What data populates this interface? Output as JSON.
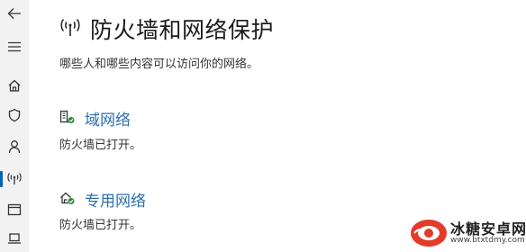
{
  "page": {
    "title": "防火墙和网络保护",
    "subtitle": "哪些人和哪些内容可以访问你的网络。",
    "header_icon": "wireless-antenna-icon"
  },
  "sidebar": {
    "items": [
      {
        "name": "back",
        "icon": "back-arrow-icon"
      },
      {
        "name": "menu",
        "icon": "hamburger-icon"
      },
      {
        "name": "home",
        "icon": "home-icon"
      },
      {
        "name": "virus-protection",
        "icon": "shield-icon"
      },
      {
        "name": "account-protection",
        "icon": "person-icon"
      },
      {
        "name": "firewall-network",
        "icon": "wireless-antenna-icon",
        "active": true
      },
      {
        "name": "app-browser-control",
        "icon": "window-icon"
      },
      {
        "name": "device-security",
        "icon": "laptop-icon"
      }
    ]
  },
  "networks": [
    {
      "label": "域网络",
      "status": "防火墙已打开。",
      "icon": "domain-network-icon"
    },
    {
      "label": "专用网络",
      "status": "防火墙已打开。",
      "icon": "private-network-icon"
    }
  ],
  "colors": {
    "accent": "#0063b1",
    "link": "#2d6fae",
    "ok_green": "#2e8b3a",
    "rail_bg": "#f2f2f2"
  },
  "watermark": {
    "title": "冰糖安卓网",
    "url": "www.btxtdmy.com"
  }
}
